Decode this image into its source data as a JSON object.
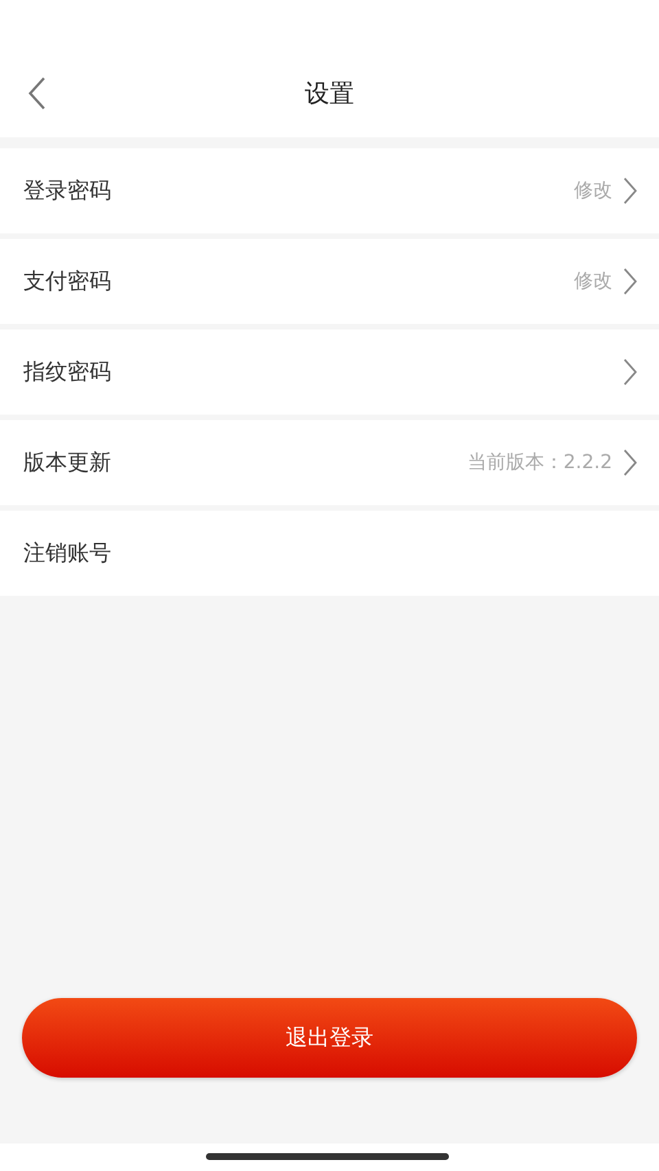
{
  "header": {
    "title": "设置"
  },
  "items": [
    {
      "label": "登录密码",
      "value": "修改",
      "chevron": true
    },
    {
      "label": "支付密码",
      "value": "修改",
      "chevron": true
    },
    {
      "label": "指纹密码",
      "chevron": true
    },
    {
      "label": "版本更新",
      "value": "当前版本：2.2.2",
      "chevron": true
    },
    {
      "label": "注销账号",
      "chevron": false
    }
  ],
  "logout_button": "退出登录"
}
